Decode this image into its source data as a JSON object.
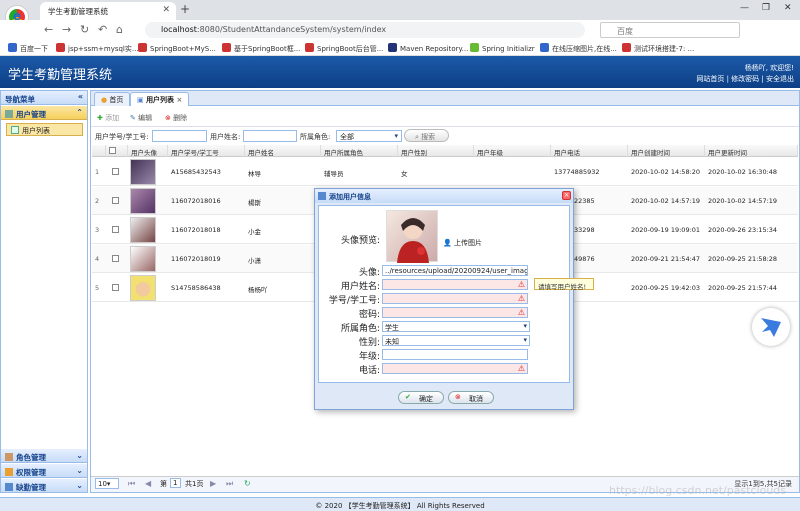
{
  "browser": {
    "tab_title": "学生考勤管理系统",
    "url_host": "localhost",
    "url_rest": ":8080/StudentAttandanceSystem/system/index",
    "search_placeholder": "百度",
    "bookmarks": [
      "百度一下",
      "jsp+ssm+mysql实...",
      "SpringBoot+MyS...",
      "基于SpringBoot框...",
      "SpringBoot后台管...",
      "Maven Repository...",
      "Spring Initializr",
      "在线压缩图片,在线...",
      "测试环境搭建-7: ..."
    ]
  },
  "app": {
    "title": "学生考勤管理系统",
    "welcome": "杨杨吖, 欢迎您!",
    "links": "网站首页 | 修改密码 | 安全退出",
    "footer": "© 2020 【学生考勤管理系统】 All Rights Reserved"
  },
  "nav": {
    "title": "导航菜单",
    "groups": [
      "用户管理",
      "角色管理",
      "权限管理",
      "缺勤管理"
    ],
    "active_item": "用户列表"
  },
  "tabs": [
    "首页",
    "用户列表"
  ],
  "toolbar": {
    "add": "添加",
    "edit": "编辑",
    "delete": "删除"
  },
  "filter": {
    "id_label": "用户学号/学工号:",
    "name_label": "用户姓名:",
    "role_label": "所属角色:",
    "role_value": "全部",
    "search": "搜索"
  },
  "grid": {
    "headers": [
      "用户头像",
      "用户学号/学工号",
      "用户姓名",
      "用户所属角色",
      "用户性别",
      "用户年级",
      "用户电话",
      "用户创建时间",
      "用户更新时间"
    ],
    "rows": [
      {
        "n": "1",
        "id": "A15685432543",
        "name": "林导",
        "role": "辅导员",
        "gender": "女",
        "grade": "",
        "phone": "13774885932",
        "created": "2020-10-02 14:58:20",
        "updated": "2020-10-02 16:30:48"
      },
      {
        "n": "2",
        "id": "116072018016",
        "name": "楊斯",
        "role": "",
        "gender": "",
        "grade": "",
        "phone": "22385",
        "created": "2020-10-02 14:57:19",
        "updated": "2020-10-02 14:57:19"
      },
      {
        "n": "3",
        "id": "116072018018",
        "name": "小金",
        "role": "",
        "gender": "",
        "grade": "",
        "phone": "33298",
        "created": "2020-09-19 19:09:01",
        "updated": "2020-09-26 23:15:34"
      },
      {
        "n": "4",
        "id": "116072018019",
        "name": "小潇",
        "role": "",
        "gender": "",
        "grade": "",
        "phone": "49876",
        "created": "2020-09-21 21:54:47",
        "updated": "2020-09-25 21:58:28"
      },
      {
        "n": "5",
        "id": "S14758586438",
        "name": "杨杨吖",
        "role": "",
        "gender": "",
        "grade": "",
        "phone": "",
        "created": "2020-09-25 19:42:03",
        "updated": "2020-09-25 21:57:44"
      }
    ]
  },
  "pager": {
    "size": "10",
    "page_label": "第",
    "page": "1",
    "total": "共1页",
    "info": "显示1到5,共5记录"
  },
  "dialog": {
    "title": "添加用户信息",
    "preview_label": "头像预览:",
    "upload": "上传图片",
    "avatar_label": "头像:",
    "avatar_value": "../resources/upload/20200924/user_image.jpg",
    "name_label": "用户姓名:",
    "id_label": "学号/学工号:",
    "pwd_label": "密码:",
    "role_label": "所属角色:",
    "role_value": "学生",
    "gender_label": "性别:",
    "gender_value": "未知",
    "grade_label": "年级:",
    "phone_label": "电话:",
    "tooltip": "请填写用户姓名!",
    "ok": "确定",
    "cancel": "取消"
  },
  "watermark": "https://blog.csdn.net/pastclouds",
  "colors": {
    "header": "#1c5aa8",
    "accent": "#15428b",
    "required": "#fde6e6"
  }
}
